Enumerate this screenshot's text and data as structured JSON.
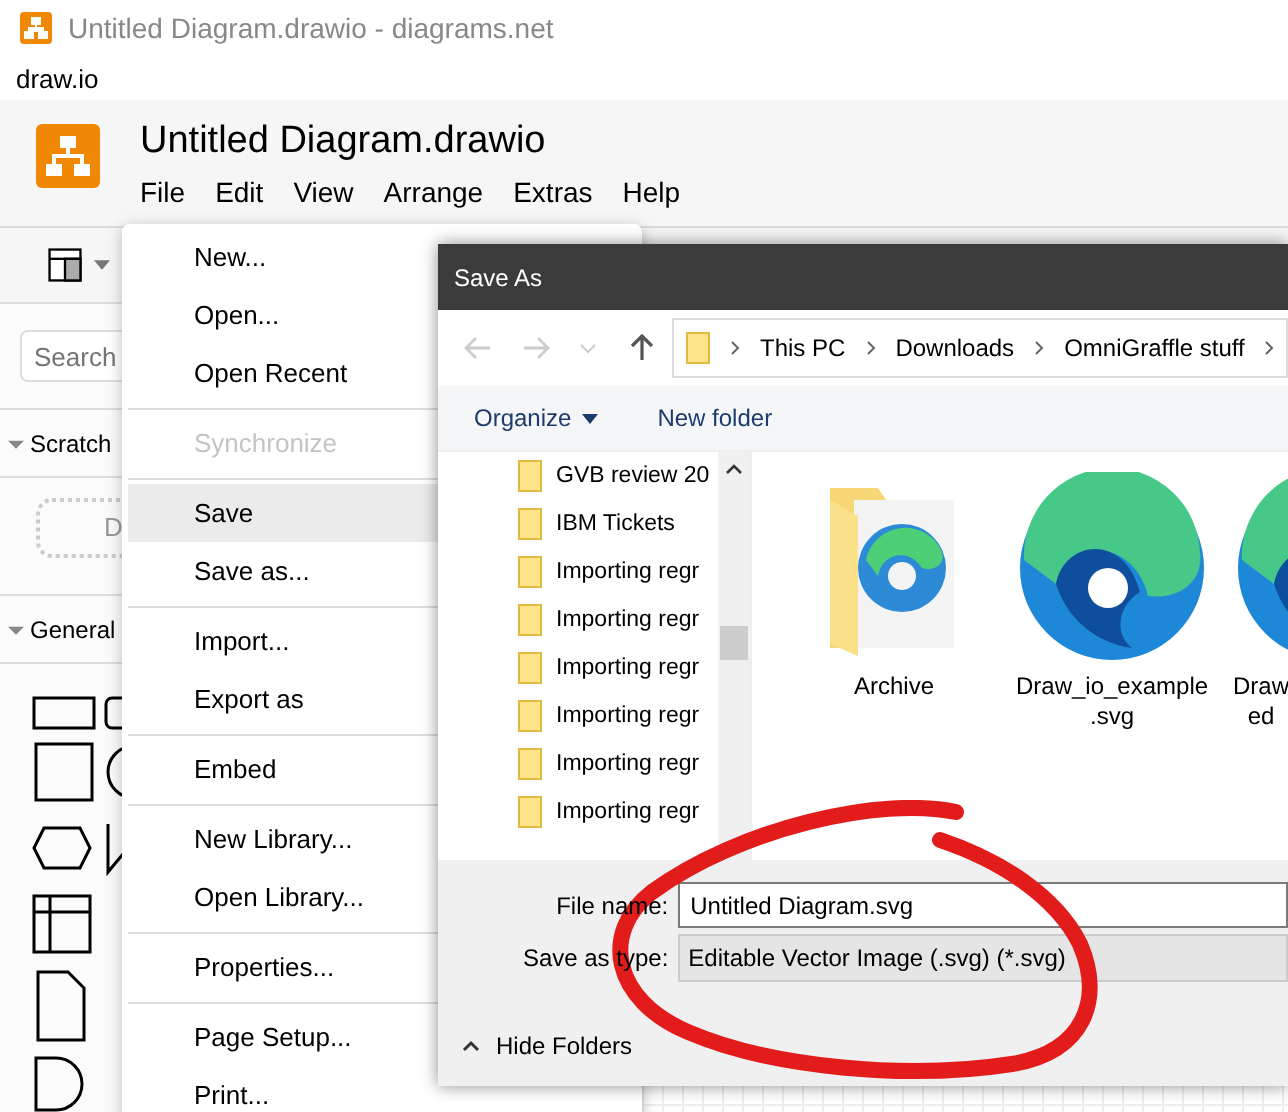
{
  "window": {
    "title": "Untitled Diagram.drawio - diagrams.net"
  },
  "app_label": "draw.io",
  "app": {
    "title": "Untitled Diagram.drawio",
    "menus": [
      "File",
      "Edit",
      "View",
      "Arrange",
      "Extras",
      "Help"
    ]
  },
  "sidebar": {
    "search": {
      "placeholder": "Search"
    },
    "sections": [
      {
        "title": "Scratch",
        "expanded": true
      },
      {
        "title": "General",
        "expanded": true
      }
    ],
    "drop_hint": "D"
  },
  "file_menu": {
    "items": [
      {
        "kind": "item",
        "label": "New...",
        "disabled": false,
        "selected": false
      },
      {
        "kind": "item",
        "label": "Open...",
        "disabled": false,
        "selected": false
      },
      {
        "kind": "item",
        "label": "Open Recent",
        "disabled": false,
        "selected": false
      },
      {
        "kind": "separator"
      },
      {
        "kind": "item",
        "label": "Synchronize",
        "disabled": true,
        "selected": false
      },
      {
        "kind": "separator"
      },
      {
        "kind": "item",
        "label": "Save",
        "disabled": false,
        "selected": true
      },
      {
        "kind": "item",
        "label": "Save as...",
        "disabled": false,
        "selected": false
      },
      {
        "kind": "separator"
      },
      {
        "kind": "item",
        "label": "Import...",
        "disabled": false,
        "selected": false
      },
      {
        "kind": "item",
        "label": "Export as",
        "disabled": false,
        "selected": false
      },
      {
        "kind": "separator"
      },
      {
        "kind": "item",
        "label": "Embed",
        "disabled": false,
        "selected": false
      },
      {
        "kind": "separator"
      },
      {
        "kind": "item",
        "label": "New Library...",
        "disabled": false,
        "selected": false
      },
      {
        "kind": "item",
        "label": "Open Library...",
        "disabled": false,
        "selected": false
      },
      {
        "kind": "separator"
      },
      {
        "kind": "item",
        "label": "Properties...",
        "disabled": false,
        "selected": false
      },
      {
        "kind": "separator"
      },
      {
        "kind": "item",
        "label": "Page Setup...",
        "disabled": false,
        "selected": false
      },
      {
        "kind": "item",
        "label": "Print...",
        "disabled": false,
        "selected": false
      }
    ]
  },
  "dialog": {
    "title": "Save As",
    "path": [
      "This PC",
      "Downloads",
      "OmniGraffle stuff"
    ],
    "commands": {
      "organize": "Organize",
      "new_folder": "New folder"
    },
    "folders": [
      "GVB review 20",
      "IBM Tickets",
      "Importing regr",
      "Importing regr",
      "Importing regr",
      "Importing regr",
      "Importing regr",
      "Importing regr"
    ],
    "files": [
      {
        "kind": "folder",
        "lines": [
          "Archive"
        ]
      },
      {
        "kind": "file",
        "lines": [
          "Draw_io_example",
          ".svg"
        ]
      },
      {
        "kind": "file",
        "lines": [
          "Draw",
          "ed"
        ]
      }
    ],
    "file_name": {
      "label": "File name:",
      "value": "Untitled Diagram.svg"
    },
    "save_type": {
      "label": "Save as type:",
      "value": "Editable Vector Image (.svg) (*.svg)"
    },
    "hide_folders": "Hide Folders"
  }
}
